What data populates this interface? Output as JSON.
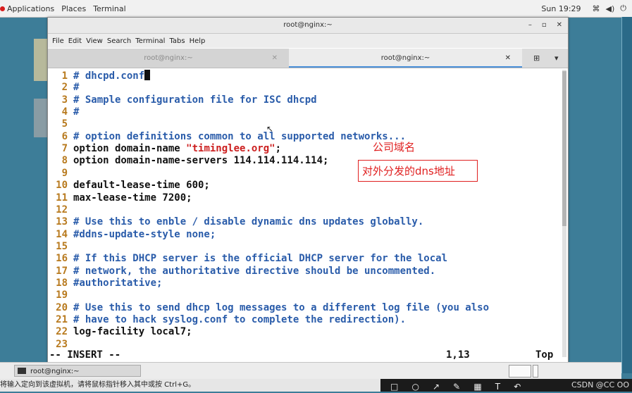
{
  "topbar": {
    "applications": "Applications",
    "places": "Places",
    "terminal": "Terminal",
    "clock": "Sun 19:29"
  },
  "window": {
    "title": "root@nginx:~",
    "menu": [
      "File",
      "Edit",
      "View",
      "Search",
      "Terminal",
      "Tabs",
      "Help"
    ],
    "tabs": [
      {
        "label": "root@nginx:~",
        "active": false
      },
      {
        "label": "root@nginx:~",
        "active": true
      }
    ]
  },
  "editor": {
    "lines": [
      {
        "n": "1",
        "segs": [
          {
            "t": "# dhcpd.conf",
            "c": "cm"
          }
        ],
        "cursor": true
      },
      {
        "n": "2",
        "segs": [
          {
            "t": "#",
            "c": "cm"
          }
        ]
      },
      {
        "n": "3",
        "segs": [
          {
            "t": "# Sample configuration file for ISC dhcpd",
            "c": "cm"
          }
        ]
      },
      {
        "n": "4",
        "segs": [
          {
            "t": "#",
            "c": "cm"
          }
        ]
      },
      {
        "n": "5",
        "segs": []
      },
      {
        "n": "6",
        "segs": [
          {
            "t": "# option definitions common to all supported networks...",
            "c": "cm"
          }
        ]
      },
      {
        "n": "7",
        "segs": [
          {
            "t": "option domain-name ",
            "c": "norm"
          },
          {
            "t": "\"timinglee.org\"",
            "c": "str"
          },
          {
            "t": ";",
            "c": "norm"
          }
        ]
      },
      {
        "n": "8",
        "segs": [
          {
            "t": "option domain-name-servers 114.114.114.114;",
            "c": "norm"
          }
        ]
      },
      {
        "n": "9",
        "segs": []
      },
      {
        "n": "10",
        "segs": [
          {
            "t": "default-lease-time 600;",
            "c": "norm"
          }
        ]
      },
      {
        "n": "11",
        "segs": [
          {
            "t": "max-lease-time 7200;",
            "c": "norm"
          }
        ]
      },
      {
        "n": "12",
        "segs": []
      },
      {
        "n": "13",
        "segs": [
          {
            "t": "# Use this to enble / disable dynamic dns updates globally.",
            "c": "cm"
          }
        ]
      },
      {
        "n": "14",
        "segs": [
          {
            "t": "#ddns-update-style none;",
            "c": "cm"
          }
        ]
      },
      {
        "n": "15",
        "segs": []
      },
      {
        "n": "16",
        "segs": [
          {
            "t": "# If this DHCP server is the official DHCP server for the local",
            "c": "cm"
          }
        ]
      },
      {
        "n": "17",
        "segs": [
          {
            "t": "# network, the authoritative directive should be uncommented.",
            "c": "cm"
          }
        ]
      },
      {
        "n": "18",
        "segs": [
          {
            "t": "#authoritative;",
            "c": "cm"
          }
        ]
      },
      {
        "n": "19",
        "segs": []
      },
      {
        "n": "20",
        "segs": [
          {
            "t": "# Use this to send dhcp log messages to a different log file (you also",
            "c": "cm"
          }
        ]
      },
      {
        "n": "21",
        "segs": [
          {
            "t": "# have to hack syslog.conf to complete the redirection).",
            "c": "cm"
          }
        ]
      },
      {
        "n": "22",
        "segs": [
          {
            "t": "log-facility local7;",
            "c": "norm"
          }
        ]
      },
      {
        "n": "23",
        "segs": []
      }
    ],
    "status": {
      "mode": "-- INSERT --",
      "position": "1,13",
      "scroll": "Top"
    }
  },
  "annotations": {
    "domain_note": "公司域名",
    "dns_note": "对外分发的dns地址"
  },
  "taskbar": {
    "item": "root@nginx:~"
  },
  "bottom": {
    "hint": "将输入定向到该虚拟机，请将鼠标指针移入其中或按 Ctrl+G。",
    "watermark": "CSDN @CC OO"
  }
}
